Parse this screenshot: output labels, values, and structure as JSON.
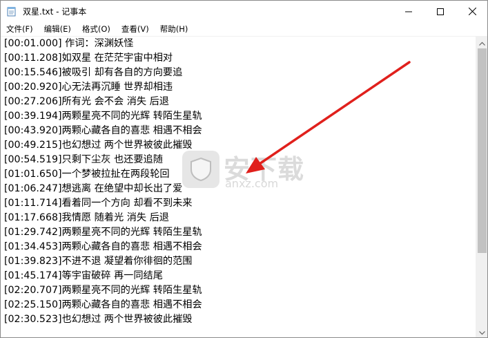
{
  "window": {
    "title": "双星.txt - 记事本",
    "controls": [
      "minimize",
      "maximize",
      "close"
    ]
  },
  "menu": {
    "items": [
      {
        "label": "文件(F)"
      },
      {
        "label": "编辑(E)"
      },
      {
        "label": "格式(O)"
      },
      {
        "label": "查看(V)"
      },
      {
        "label": "帮助(H)"
      }
    ]
  },
  "editor": {
    "lines": [
      "[00:01.000] 作词：深渊妖怪",
      "[00:11.208]如双星 在茫茫宇宙中相对",
      "[00:15.546]被吸引 却有各自的方向要追",
      "[00:20.920]心无法再沉睡 世界却相违",
      "[00:27.206]所有光 会不会 消失 后退",
      "[00:39.194]两颗星亮不同的光辉 转陌生星轨",
      "[00:43.920]两颗心藏各自的喜悲 相遇不相会",
      "[00:49.215]也幻想过 两个世界被彼此摧毁",
      "[00:54.519]只剩下尘灰 也还要追随",
      "[01:01.650]一个梦被拉扯在两段轮回",
      "[01:06.247]想逃离 在绝望中却长出了爱",
      "[01:11.714]看着同一个方向 却看不到未来",
      "[01:17.668]我情愿 随着光 消失 后退",
      "[01:29.742]两颗星亮不同的光辉 转陌生星轨",
      "[01:34.453]两颗心藏各自的喜悲 相遇不相会",
      "[01:39.823]不进不退 凝望着你徘徊的范围",
      "[01:45.174]等宇宙破碎 再一同结尾",
      "[02:20.707]两颗星亮不同的光辉 转陌生星轨",
      "[02:25.150]两颗心藏各自的喜悲 相遇不相会",
      "[02:30.523]也幻想过 两个世界被彼此摧毁"
    ]
  },
  "watermark": {
    "brand": "安下载",
    "domain": "anxz.com"
  },
  "colors": {
    "arrow": "#e0201c",
    "scrollbar_track": "#f0f0f0",
    "scrollbar_thumb": "#c2c2c2"
  },
  "icons": {
    "app": "notepad-icon",
    "minimize": "minimize-icon",
    "maximize": "maximize-icon",
    "close": "close-icon",
    "scroll_up": "chevron-up-icon",
    "scroll_down": "chevron-down-icon"
  }
}
